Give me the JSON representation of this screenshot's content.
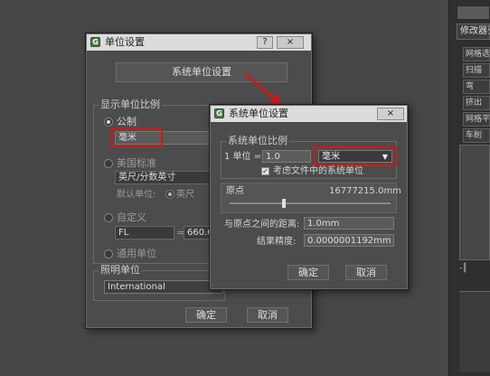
{
  "background": {
    "right_panel_tab": "修改器列",
    "right_panel_buttons": [
      "网格选择",
      "扫描",
      "弯",
      "挤出",
      "网格平滑",
      "车削"
    ],
    "right_panel_bottom_icon": "-║"
  },
  "units_dialog": {
    "title": "单位设置",
    "help_btn": "?",
    "close_btn": "×",
    "system_units_btn": "系统单位设置",
    "display_group_label": "显示单位比例",
    "metric_label": "公制",
    "metric_value": "毫米",
    "us_standard_label": "美国标准",
    "us_value": "英尺/分数英寸",
    "default_units_label": "默认单位:",
    "feet_option": "英尺",
    "custom_label": "自定义",
    "custom_name": "FL",
    "custom_value": "660.0",
    "generic_label": "通用单位",
    "lighting_group_label": "照明单位",
    "lighting_value": "International",
    "ok": "确定",
    "cancel": "取消"
  },
  "system_dialog": {
    "title": "系统单位设置",
    "close_btn": "×",
    "group_label": "系统单位比例",
    "unit_prefix": "1 单位 =",
    "unit_value": "1.0",
    "unit_select": "毫米",
    "respect_checkbox": "考虑文件中的系统单位",
    "origin_label": "原点",
    "origin_value": "16777215.0mm",
    "distance_label": "与原点之间的距离:",
    "distance_value": "1.0mm",
    "precision_label": "结果精度:",
    "precision_value": "0.0000001192mm",
    "ok": "确定",
    "cancel": "取消"
  },
  "colors": {
    "highlight_red": "#d01818",
    "dialog_bg": "#4c4c4c",
    "titlebar_bg": "#dcdcdc"
  },
  "icons": {
    "app_icon": "max-logo-icon",
    "arrow": "red-arrow-annotation",
    "dropdown": "triangle-down-icon",
    "checkbox": "checkmark-icon"
  }
}
